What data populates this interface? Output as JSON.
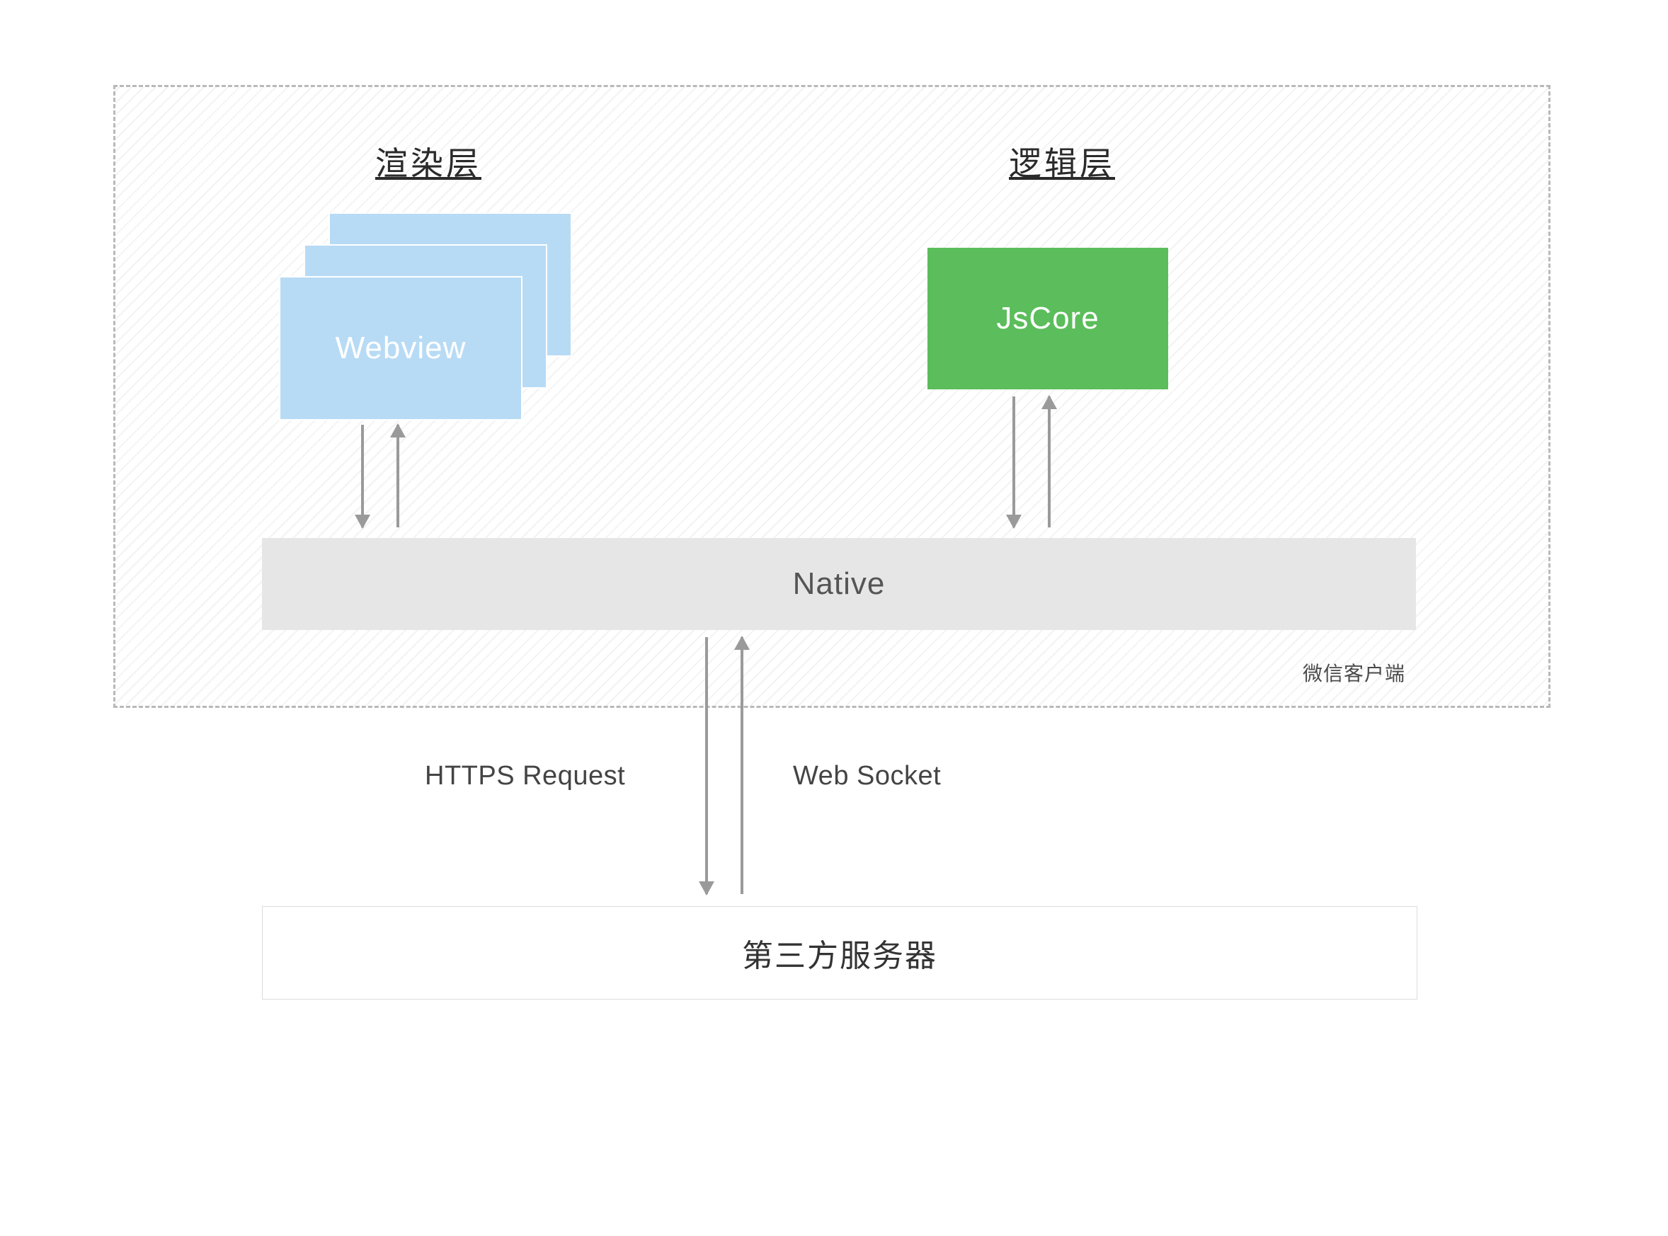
{
  "client": {
    "label": "微信客户端",
    "render_layer_title": "渲染层",
    "logic_layer_title": "逻辑层",
    "webview_label": "Webview",
    "jscore_label": "JsCore",
    "native_label": "Native"
  },
  "network": {
    "request_label": "HTTPS Request",
    "socket_label": "Web Socket"
  },
  "server": {
    "label": "第三方服务器"
  }
}
